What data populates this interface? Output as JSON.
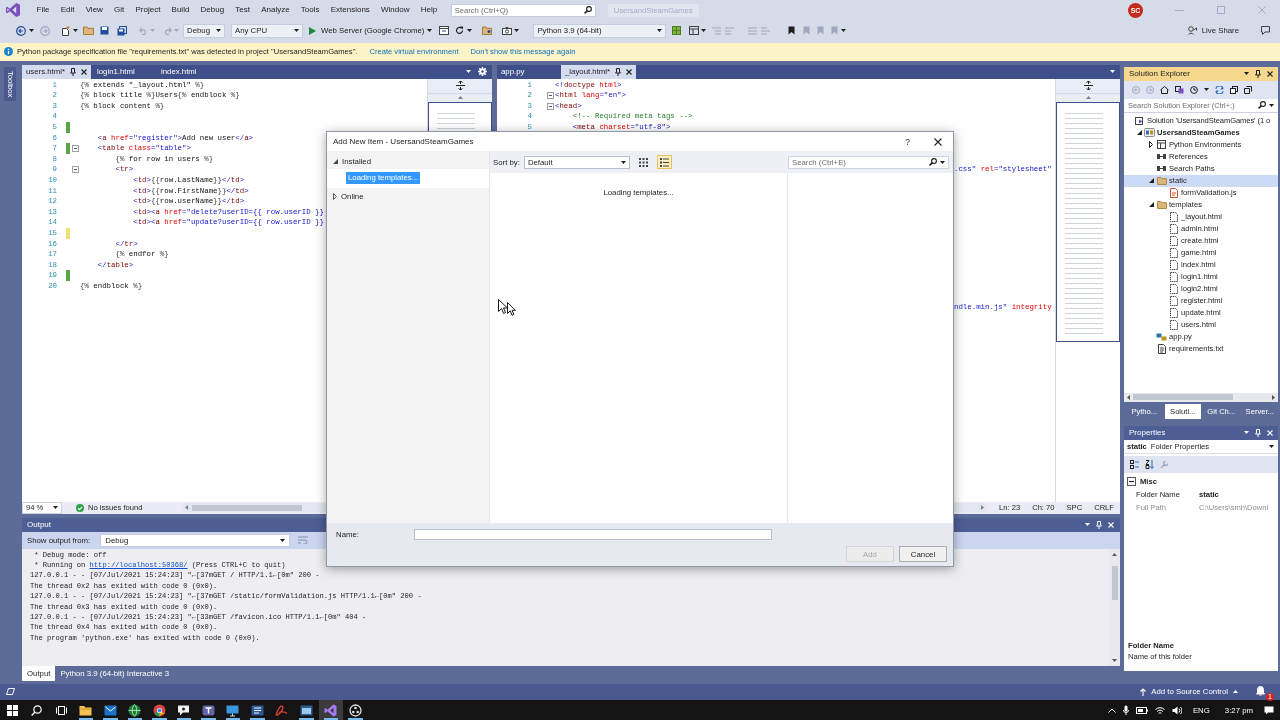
{
  "menu_bar": {
    "menus": [
      "File",
      "Edit",
      "View",
      "Git",
      "Project",
      "Build",
      "Debug",
      "Test",
      "Analyze",
      "Tools",
      "Extensions",
      "Window",
      "Help"
    ],
    "search": {
      "placeholder": "Search (Ctrl+Q)"
    },
    "solution_name": "UsersandSteamGames",
    "account": "SC"
  },
  "toolbar": {
    "configuration": "Debug",
    "platform": "Any CPU",
    "run_target": "Web Server (Google Chrome)",
    "environment": "Python 3.9 (64-bit)",
    "live_share": "Live Share"
  },
  "info_bar": {
    "message": "Python package specification file \"requirements.txt\" was detected in project \"UsersandSteamGames\".",
    "links": [
      "Create virtual environment",
      "Don't show this message again"
    ]
  },
  "toolbox": {
    "label": "Toolbox"
  },
  "editors": [
    {
      "tabs": [
        {
          "label": "users.html*",
          "selected": true
        },
        {
          "label": "login1.html",
          "selected": false
        },
        {
          "label": "index.html",
          "selected": false
        }
      ],
      "lines": [
        {
          "number": "1",
          "text": "{% extends \"_layout.html\" %}",
          "fold": false
        },
        {
          "number": "2",
          "text": "{% block title %}Users{% endblock %}",
          "fold": false
        },
        {
          "number": "3",
          "text": "{% block content %}",
          "fold": false
        },
        {
          "number": "4",
          "fold": false
        },
        {
          "number": "5",
          "fold": false,
          "color": "#57a64a"
        },
        {
          "number": "6",
          "text": "    <a href=\"register\">Add new user</a>",
          "fold": false
        },
        {
          "number": "7",
          "text": "    <table class=\"table\">",
          "fold": true,
          "color": "#57a64a"
        },
        {
          "number": "8",
          "text": "        {% for row in users %}",
          "fold": false
        },
        {
          "number": "9",
          "text": "        <tr>",
          "fold": true
        },
        {
          "number": "10",
          "text": "            <td>{{row.LastName}}</td>",
          "fold": false
        },
        {
          "number": "11",
          "text": "            <td>{{row.FirstName}}</td>",
          "fold": false
        },
        {
          "number": "12",
          "text": "            <td>{{row.userName}}</td>",
          "fold": false
        },
        {
          "number": "13",
          "text": "            <td><a href=\"delete?userID={{ row.userID }}",
          "fold": false
        },
        {
          "number": "14",
          "text": "            <td><a href=\"update?userID={{ row.userID }}",
          "fold": false
        },
        {
          "number": "15",
          "fold": false,
          "color": "#efe16c"
        },
        {
          "number": "16",
          "text": "        </tr>",
          "fold": false
        },
        {
          "number": "17",
          "text": "        {% endfor %}",
          "fold": false
        },
        {
          "number": "18",
          "text": "    </table>",
          "fold": false
        },
        {
          "number": "19",
          "fold": false,
          "color": "#57a64a"
        },
        {
          "number": "20",
          "text": "{% endblock %}",
          "fold": false
        }
      ],
      "zoom": "94 %",
      "issues": "No issues found"
    },
    {
      "tabs": [
        {
          "label": "app.py",
          "selected": false
        },
        {
          "label": "_layout.html*",
          "selected": true
        }
      ],
      "lines": [
        {
          "number": "1",
          "text": "<!doctype html>",
          "fold": false
        },
        {
          "number": "2",
          "text": "<html lang=\"en\">",
          "fold": true
        },
        {
          "number": "3",
          "text": "<head>",
          "fold": true
        },
        {
          "number": "4",
          "text": "    <!-- Required meta tags -->",
          "fold": false
        },
        {
          "number": "5",
          "text": "    <meta charset=\"utf-8\">",
          "fold": false
        }
      ],
      "peeking_text": [
        ".css\" rel=\"stylesheet\"",
        "ndle.min.js\" integrity"
      ],
      "status": [
        "Ln: 23",
        "Ch: 70",
        "SPC",
        "CRLF"
      ]
    }
  ],
  "output": {
    "title": "Output",
    "source_label": "Show output from:",
    "source": "Debug",
    "lines": [
      {
        "text": " * Debug mode: off"
      },
      {
        "text": " * Running on ",
        "link": "http://localhost:50368/",
        "after": " (Press CTRL+C to quit)"
      },
      {
        "text": "127.0.0.1 - - [07/Jul/2021 15:24:23] \"←[37mGET / HTTP/1.1←[0m\" 200 -"
      },
      {
        "text": "The thread 0x2 has exited with code 0 (0x0)."
      },
      {
        "text": "127.0.0.1 - - [07/Jul/2021 15:24:23] \"←[37mGET /static/formValidation.js HTTP/1.1←[0m\" 200 -"
      },
      {
        "text": "The thread 0x3 has exited with code 0 (0x0)."
      },
      {
        "text": "127.0.0.1 - - [07/Jul/2021 15:24:23] \"←[33mGET /favicon.ico HTTP/1.1←[0m\" 404 -"
      },
      {
        "text": "The thread 0x4 has exited with code 0 (0x0)."
      },
      {
        "text": "The program 'python.exe' has exited with code 0 (0x0)."
      }
    ],
    "tabs": [
      {
        "label": "Output",
        "selected": true
      },
      {
        "label": "Python 3.9 (64-bit) Interactive 3",
        "selected": false
      }
    ]
  },
  "solution_explorer": {
    "title": "Solution Explorer",
    "search": {
      "placeholder": "Search Solution Explorer (Ctrl+;)"
    },
    "tree": [
      {
        "label": "Solution 'UsersandSteamGames' (1 o",
        "kind": "solution",
        "selected": false,
        "children": [
          {
            "label": "UsersandSteamGames",
            "kind": "project",
            "selected": false,
            "expanded": true,
            "children": [
              {
                "label": "Python Environments",
                "kind": "environments",
                "selected": false,
                "expanded": false
              },
              {
                "label": "References",
                "kind": "references",
                "selected": false
              },
              {
                "label": "Search Paths",
                "kind": "references",
                "selected": false
              },
              {
                "label": "static",
                "kind": "folder",
                "selected": true,
                "expanded": true,
                "children": [
                  {
                    "label": "formValidation.js",
                    "kind": "script",
                    "selected": false
                  }
                ]
              },
              {
                "label": "templates",
                "kind": "folder",
                "selected": false,
                "expanded": true,
                "children": [
                  {
                    "label": "_layout.html",
                    "kind": "html",
                    "selected": false
                  },
                  {
                    "label": "admin.html",
                    "kind": "html",
                    "selected": false
                  },
                  {
                    "label": "create.html",
                    "kind": "html",
                    "selected": false
                  },
                  {
                    "label": "game.html",
                    "kind": "html",
                    "selected": false
                  },
                  {
                    "label": "index.html",
                    "kind": "html",
                    "selected": false
                  },
                  {
                    "label": "login1.html",
                    "kind": "html",
                    "selected": false
                  },
                  {
                    "label": "login2.html",
                    "kind": "html",
                    "selected": false
                  },
                  {
                    "label": "register.html",
                    "kind": "html",
                    "selected": false
                  },
                  {
                    "label": "update.html",
                    "kind": "html",
                    "selected": false
                  },
                  {
                    "label": "users.html",
                    "kind": "html",
                    "selected": false
                  }
                ]
              },
              {
                "label": "app.py",
                "kind": "python",
                "selected": false
              },
              {
                "label": "requirements.txt",
                "kind": "text",
                "selected": false
              }
            ]
          }
        ]
      }
    ],
    "tabs": [
      {
        "label": "Pytho...",
        "selected": false
      },
      {
        "label": "Soluti...",
        "selected": true
      },
      {
        "label": "Git Ch...",
        "selected": false
      },
      {
        "label": "Server...",
        "selected": false
      }
    ]
  },
  "properties": {
    "title": "Properties",
    "object": "static",
    "object_type": "Folder Properties",
    "category": {
      "label": "Misc",
      "expanded": true
    },
    "rows": [
      {
        "name": "Folder Name",
        "value": "static",
        "disabled": false
      },
      {
        "name": "Full Path",
        "value": "C:\\Users\\smh\\Downl",
        "disabled": true
      }
    ],
    "description_title": "Folder Name",
    "description": "Name of this folder"
  },
  "status_bar": {
    "source_control": "Add to Source Control",
    "notifications": "1"
  },
  "taskbar": {
    "apps": [
      {
        "kind": "files",
        "running": true,
        "selected": false
      },
      {
        "kind": "mail",
        "running": true,
        "selected": false
      },
      {
        "kind": "globe",
        "running": true,
        "selected": false
      },
      {
        "kind": "browser",
        "running": true,
        "selected": false
      },
      {
        "kind": "chat",
        "running": true,
        "selected": false
      },
      {
        "kind": "team",
        "running": true,
        "selected": false
      },
      {
        "kind": "monitor",
        "running": true,
        "selected": false
      },
      {
        "kind": "document",
        "running": true,
        "selected": false
      },
      {
        "kind": "reader",
        "running": false,
        "selected": false
      },
      {
        "kind": "app",
        "running": true,
        "selected": false
      },
      {
        "kind": "studio",
        "running": true,
        "selected": true
      },
      {
        "kind": "capture",
        "running": true,
        "selected": false
      }
    ],
    "language": "ENG",
    "time": "3:27 pm"
  },
  "dialog": {
    "title": "Add New Item - UsersandSteamGames",
    "help_button": "?",
    "tree": [
      {
        "label": "Installed",
        "selected": false,
        "expanded": true,
        "children": [
          {
            "label": "Loading templates...",
            "selected": true
          }
        ]
      },
      {
        "label": "Online",
        "selected": false,
        "expanded": false
      }
    ],
    "sort_label": "Sort by:",
    "sort": "Default",
    "views": [
      {
        "kind": "grid",
        "selected": false
      },
      {
        "kind": "list",
        "selected": true
      }
    ],
    "search": {
      "placeholder": "Search (Ctrl+E)"
    },
    "message": "Loading templates...",
    "name_label": "Name:",
    "buttons": [
      {
        "label": "Add",
        "disabled": true
      },
      {
        "label": "Cancel",
        "disabled": false
      }
    ]
  }
}
